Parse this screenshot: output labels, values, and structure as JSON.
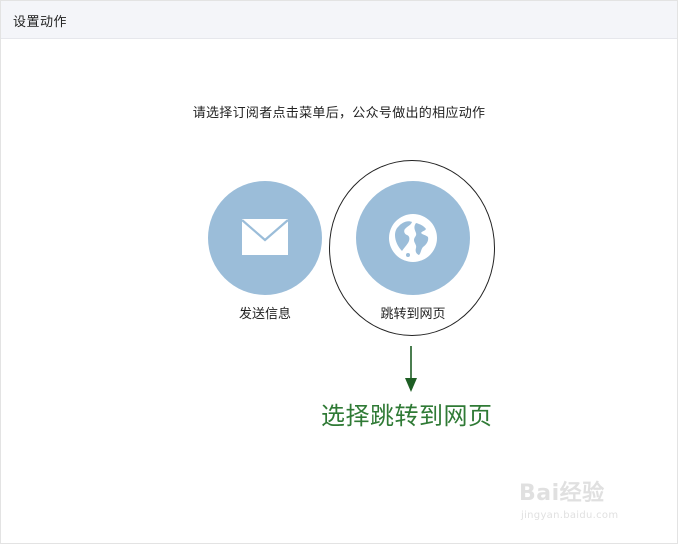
{
  "header": {
    "title": "设置动作"
  },
  "instruction": "请选择订阅者点击菜单后，公众号做出的相应动作",
  "options": [
    {
      "label": "发送信息",
      "icon": "mail-icon"
    },
    {
      "label": "跳转到网页",
      "icon": "globe-icon"
    }
  ],
  "annotation": {
    "text": "选择跳转到网页",
    "color": "#2f7a35"
  },
  "watermark": {
    "brand": "Bai经验",
    "url": "jingyan.baidu.com"
  },
  "colors": {
    "circle_fill": "#9bbdd9",
    "header_bg": "#f4f5f9"
  }
}
